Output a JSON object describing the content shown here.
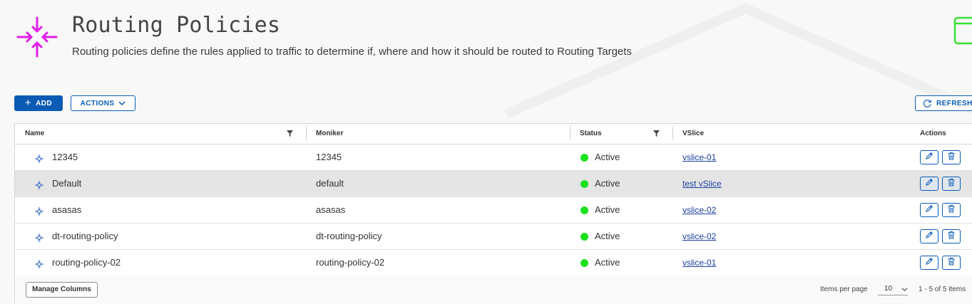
{
  "header": {
    "title": "Routing Policies",
    "description": "Routing policies define the rules applied to traffic to determine if, where and how it should be routed to Routing Targets",
    "icon": "routing-policy-icon",
    "accent_color": "#e11de8"
  },
  "toolbar": {
    "add_label": "ADD",
    "actions_label": "ACTIONS",
    "refresh_label": "REFRESH"
  },
  "table": {
    "columns": [
      "Name",
      "Moniker",
      "Status",
      "VSlice",
      "Actions"
    ],
    "rows": [
      {
        "name": "12345",
        "moniker": "12345",
        "status": "Active",
        "vslice": "vslice-01",
        "selected": false
      },
      {
        "name": "Default",
        "moniker": "default",
        "status": "Active",
        "vslice": "test vSlice",
        "selected": true
      },
      {
        "name": "asasas",
        "moniker": "asasas",
        "status": "Active",
        "vslice": "vslice-02",
        "selected": false
      },
      {
        "name": "dt-routing-policy",
        "moniker": "dt-routing-policy",
        "status": "Active",
        "vslice": "vslice-02",
        "selected": false
      },
      {
        "name": "routing-policy-02",
        "moniker": "routing-policy-02",
        "status": "Active",
        "vslice": "vslice-01",
        "selected": false
      }
    ],
    "status_color": "#1ee11e"
  },
  "footer": {
    "manage_columns_label": "Manage Columns",
    "items_per_page_label": "Items per page",
    "items_per_page_value": "10",
    "range_label": "1 - 5 of 5 items"
  }
}
